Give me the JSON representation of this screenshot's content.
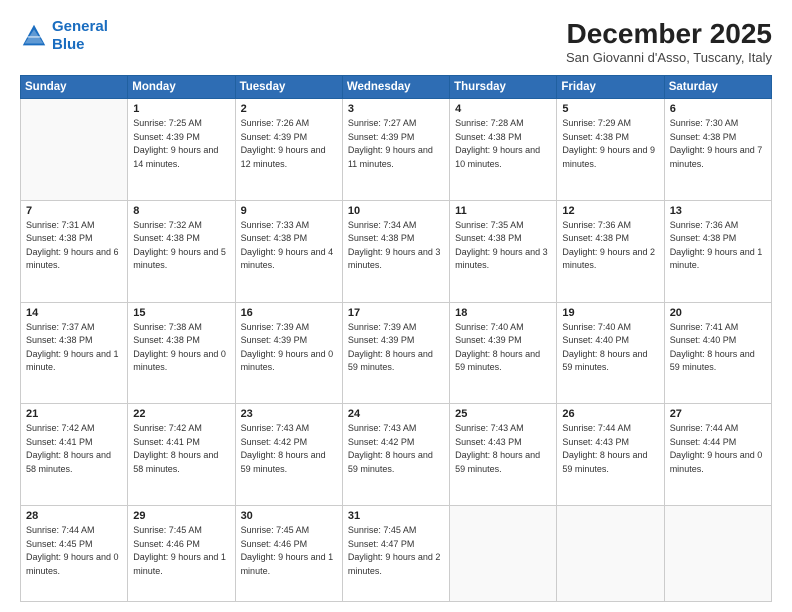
{
  "header": {
    "logo_line1": "General",
    "logo_line2": "Blue",
    "month_title": "December 2025",
    "location": "San Giovanni d'Asso, Tuscany, Italy"
  },
  "weekdays": [
    "Sunday",
    "Monday",
    "Tuesday",
    "Wednesday",
    "Thursday",
    "Friday",
    "Saturday"
  ],
  "weeks": [
    [
      {
        "day": "",
        "sunrise": "",
        "sunset": "",
        "daylight": ""
      },
      {
        "day": "1",
        "sunrise": "Sunrise: 7:25 AM",
        "sunset": "Sunset: 4:39 PM",
        "daylight": "Daylight: 9 hours and 14 minutes."
      },
      {
        "day": "2",
        "sunrise": "Sunrise: 7:26 AM",
        "sunset": "Sunset: 4:39 PM",
        "daylight": "Daylight: 9 hours and 12 minutes."
      },
      {
        "day": "3",
        "sunrise": "Sunrise: 7:27 AM",
        "sunset": "Sunset: 4:39 PM",
        "daylight": "Daylight: 9 hours and 11 minutes."
      },
      {
        "day": "4",
        "sunrise": "Sunrise: 7:28 AM",
        "sunset": "Sunset: 4:38 PM",
        "daylight": "Daylight: 9 hours and 10 minutes."
      },
      {
        "day": "5",
        "sunrise": "Sunrise: 7:29 AM",
        "sunset": "Sunset: 4:38 PM",
        "daylight": "Daylight: 9 hours and 9 minutes."
      },
      {
        "day": "6",
        "sunrise": "Sunrise: 7:30 AM",
        "sunset": "Sunset: 4:38 PM",
        "daylight": "Daylight: 9 hours and 7 minutes."
      }
    ],
    [
      {
        "day": "7",
        "sunrise": "Sunrise: 7:31 AM",
        "sunset": "Sunset: 4:38 PM",
        "daylight": "Daylight: 9 hours and 6 minutes."
      },
      {
        "day": "8",
        "sunrise": "Sunrise: 7:32 AM",
        "sunset": "Sunset: 4:38 PM",
        "daylight": "Daylight: 9 hours and 5 minutes."
      },
      {
        "day": "9",
        "sunrise": "Sunrise: 7:33 AM",
        "sunset": "Sunset: 4:38 PM",
        "daylight": "Daylight: 9 hours and 4 minutes."
      },
      {
        "day": "10",
        "sunrise": "Sunrise: 7:34 AM",
        "sunset": "Sunset: 4:38 PM",
        "daylight": "Daylight: 9 hours and 3 minutes."
      },
      {
        "day": "11",
        "sunrise": "Sunrise: 7:35 AM",
        "sunset": "Sunset: 4:38 PM",
        "daylight": "Daylight: 9 hours and 3 minutes."
      },
      {
        "day": "12",
        "sunrise": "Sunrise: 7:36 AM",
        "sunset": "Sunset: 4:38 PM",
        "daylight": "Daylight: 9 hours and 2 minutes."
      },
      {
        "day": "13",
        "sunrise": "Sunrise: 7:36 AM",
        "sunset": "Sunset: 4:38 PM",
        "daylight": "Daylight: 9 hours and 1 minute."
      }
    ],
    [
      {
        "day": "14",
        "sunrise": "Sunrise: 7:37 AM",
        "sunset": "Sunset: 4:38 PM",
        "daylight": "Daylight: 9 hours and 1 minute."
      },
      {
        "day": "15",
        "sunrise": "Sunrise: 7:38 AM",
        "sunset": "Sunset: 4:38 PM",
        "daylight": "Daylight: 9 hours and 0 minutes."
      },
      {
        "day": "16",
        "sunrise": "Sunrise: 7:39 AM",
        "sunset": "Sunset: 4:39 PM",
        "daylight": "Daylight: 9 hours and 0 minutes."
      },
      {
        "day": "17",
        "sunrise": "Sunrise: 7:39 AM",
        "sunset": "Sunset: 4:39 PM",
        "daylight": "Daylight: 8 hours and 59 minutes."
      },
      {
        "day": "18",
        "sunrise": "Sunrise: 7:40 AM",
        "sunset": "Sunset: 4:39 PM",
        "daylight": "Daylight: 8 hours and 59 minutes."
      },
      {
        "day": "19",
        "sunrise": "Sunrise: 7:40 AM",
        "sunset": "Sunset: 4:40 PM",
        "daylight": "Daylight: 8 hours and 59 minutes."
      },
      {
        "day": "20",
        "sunrise": "Sunrise: 7:41 AM",
        "sunset": "Sunset: 4:40 PM",
        "daylight": "Daylight: 8 hours and 59 minutes."
      }
    ],
    [
      {
        "day": "21",
        "sunrise": "Sunrise: 7:42 AM",
        "sunset": "Sunset: 4:41 PM",
        "daylight": "Daylight: 8 hours and 58 minutes."
      },
      {
        "day": "22",
        "sunrise": "Sunrise: 7:42 AM",
        "sunset": "Sunset: 4:41 PM",
        "daylight": "Daylight: 8 hours and 58 minutes."
      },
      {
        "day": "23",
        "sunrise": "Sunrise: 7:43 AM",
        "sunset": "Sunset: 4:42 PM",
        "daylight": "Daylight: 8 hours and 59 minutes."
      },
      {
        "day": "24",
        "sunrise": "Sunrise: 7:43 AM",
        "sunset": "Sunset: 4:42 PM",
        "daylight": "Daylight: 8 hours and 59 minutes."
      },
      {
        "day": "25",
        "sunrise": "Sunrise: 7:43 AM",
        "sunset": "Sunset: 4:43 PM",
        "daylight": "Daylight: 8 hours and 59 minutes."
      },
      {
        "day": "26",
        "sunrise": "Sunrise: 7:44 AM",
        "sunset": "Sunset: 4:43 PM",
        "daylight": "Daylight: 8 hours and 59 minutes."
      },
      {
        "day": "27",
        "sunrise": "Sunrise: 7:44 AM",
        "sunset": "Sunset: 4:44 PM",
        "daylight": "Daylight: 9 hours and 0 minutes."
      }
    ],
    [
      {
        "day": "28",
        "sunrise": "Sunrise: 7:44 AM",
        "sunset": "Sunset: 4:45 PM",
        "daylight": "Daylight: 9 hours and 0 minutes."
      },
      {
        "day": "29",
        "sunrise": "Sunrise: 7:45 AM",
        "sunset": "Sunset: 4:46 PM",
        "daylight": "Daylight: 9 hours and 1 minute."
      },
      {
        "day": "30",
        "sunrise": "Sunrise: 7:45 AM",
        "sunset": "Sunset: 4:46 PM",
        "daylight": "Daylight: 9 hours and 1 minute."
      },
      {
        "day": "31",
        "sunrise": "Sunrise: 7:45 AM",
        "sunset": "Sunset: 4:47 PM",
        "daylight": "Daylight: 9 hours and 2 minutes."
      },
      {
        "day": "",
        "sunrise": "",
        "sunset": "",
        "daylight": ""
      },
      {
        "day": "",
        "sunrise": "",
        "sunset": "",
        "daylight": ""
      },
      {
        "day": "",
        "sunrise": "",
        "sunset": "",
        "daylight": ""
      }
    ]
  ]
}
